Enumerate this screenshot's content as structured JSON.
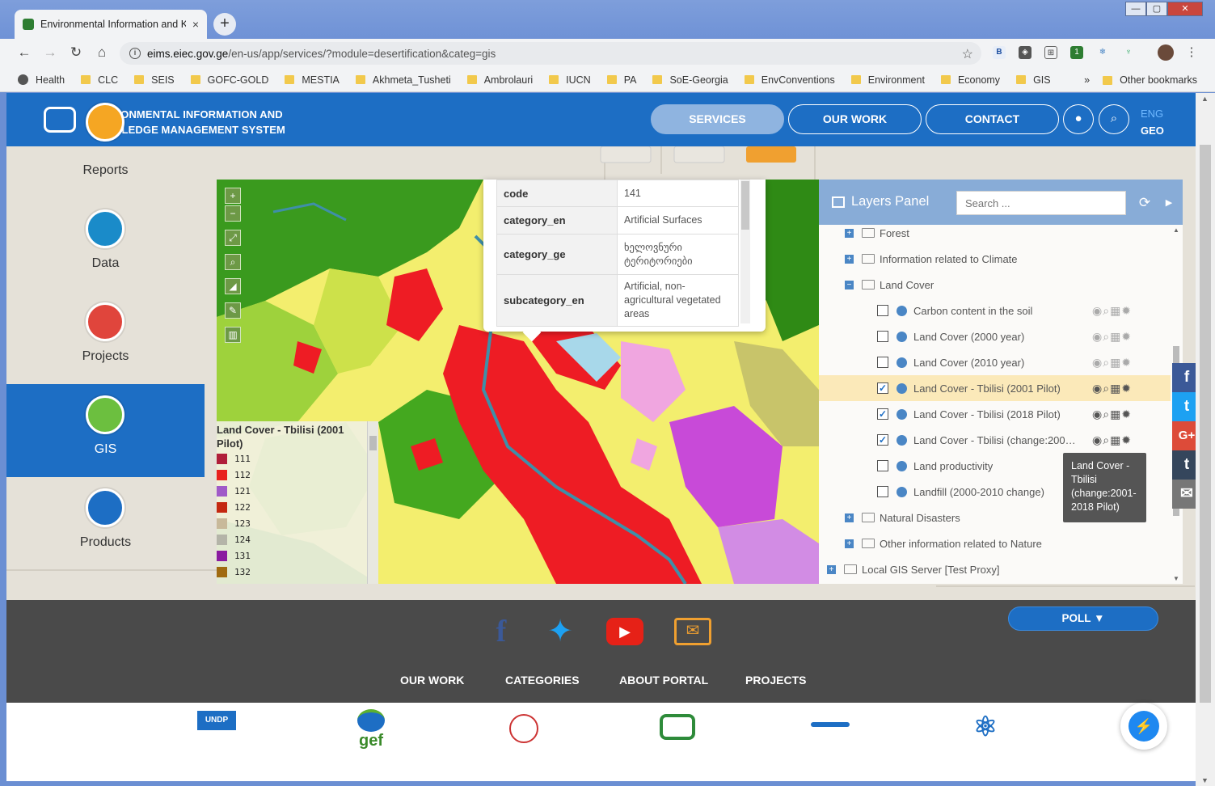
{
  "browser": {
    "tab_title": "Environmental Information and K",
    "tab_close": "×",
    "new_tab": "+",
    "url_domain": "eims.eiec.gov.ge",
    "url_path": "/en-us/app/services/?module=desertification&categ=gis",
    "bookmarks": [
      "Health",
      "CLC",
      "SEIS",
      "GOFC-GOLD",
      "MESTIA",
      "Akhmeta_Tusheti",
      "Ambrolauri",
      "IUCN",
      "PA",
      "SoE-Georgia",
      "EnvConventions",
      "Environment",
      "Economy",
      "GIS"
    ],
    "bookmarks_overflow": "»",
    "other_bookmarks": "Other bookmarks",
    "ext_badge": "1"
  },
  "header": {
    "title_line1": "ENVIRONMENTAL INFORMATION AND",
    "title_line2": "KNOWLEDGE MANAGEMENT SYSTEM",
    "nav": [
      "SERVICES",
      "OUR WORK",
      "CONTACT"
    ],
    "lang_eng": "ENG",
    "lang_geo": "GEO"
  },
  "sidebar": {
    "items": [
      {
        "label": "Reports",
        "color": "#f5a623"
      },
      {
        "label": "Data",
        "color": "#1a8bc9"
      },
      {
        "label": "Projects",
        "color": "#e0453c"
      },
      {
        "label": "GIS",
        "color": "#6cbf3f"
      },
      {
        "label": "Products",
        "color": "#1d6ec4"
      }
    ]
  },
  "map": {
    "zoom_in": "+",
    "zoom_out": "−"
  },
  "legend": {
    "title": "Land Cover - Tbilisi (2001 Pilot)",
    "rows": [
      {
        "code": "111",
        "color": "#b01e3a"
      },
      {
        "code": "112",
        "color": "#e8211e"
      },
      {
        "code": "121",
        "color": "#a05ac8"
      },
      {
        "code": "122",
        "color": "#c42810"
      },
      {
        "code": "123",
        "color": "#c8b99a"
      },
      {
        "code": "124",
        "color": "#b4b4a8"
      },
      {
        "code": "131",
        "color": "#8a1aa0"
      },
      {
        "code": "132",
        "color": "#a06a10"
      }
    ]
  },
  "popup": {
    "rows": [
      {
        "key": "code",
        "value": "141"
      },
      {
        "key": "category_en",
        "value": "Artificial Surfaces"
      },
      {
        "key": "category_ge",
        "value": "ხელოვნური ტერიტორიები"
      },
      {
        "key": "subcategory_en",
        "value": "Artificial, non-agricultural vegetated areas"
      }
    ]
  },
  "layers_panel": {
    "title": "Layers Panel",
    "search_placeholder": "Search ...",
    "rows": [
      {
        "label": "Forest",
        "kind": "group",
        "expanded": false
      },
      {
        "label": "Information related to Climate",
        "kind": "group",
        "expanded": false
      },
      {
        "label": "Land Cover",
        "kind": "group",
        "expanded": true
      },
      {
        "label": "Carbon content in the soil",
        "kind": "layer",
        "checked": false
      },
      {
        "label": "Land Cover (2000 year)",
        "kind": "layer",
        "checked": false
      },
      {
        "label": "Land Cover (2010 year)",
        "kind": "layer",
        "checked": false
      },
      {
        "label": "Land Cover - Tbilisi (2001 Pilot)",
        "kind": "layer",
        "checked": true
      },
      {
        "label": "Land Cover - Tbilisi (2018 Pilot)",
        "kind": "layer",
        "checked": true
      },
      {
        "label": "Land Cover - Tbilisi (change:2001...",
        "kind": "layer",
        "checked": true
      },
      {
        "label": "Land productivity",
        "kind": "layer",
        "checked": false
      },
      {
        "label": "Landfill (2000-2010 change)",
        "kind": "layer",
        "checked": false
      },
      {
        "label": "Natural Disasters",
        "kind": "group",
        "expanded": false
      },
      {
        "label": "Other information related to Nature",
        "kind": "group",
        "expanded": false
      },
      {
        "label": "Local GIS Server [Test Proxy]",
        "kind": "root",
        "expanded": false
      }
    ],
    "tooltip": "Land Cover - Tbilisi (change:2001-2018 Pilot)"
  },
  "social": [
    {
      "name": "facebook",
      "glyph": "f",
      "color": "#3b5998"
    },
    {
      "name": "twitter",
      "glyph": "t",
      "color": "#1da1f2"
    },
    {
      "name": "google-plus",
      "glyph": "G+",
      "color": "#dd4b39"
    },
    {
      "name": "tumblr",
      "glyph": "t",
      "color": "#35465c"
    },
    {
      "name": "email",
      "glyph": "✉",
      "color": "#777777"
    }
  ],
  "footer": {
    "links": [
      "OUR WORK",
      "CATEGORIES",
      "ABOUT PORTAL",
      "PROJECTS"
    ],
    "poll": "POLL",
    "partners": [
      "UNDP",
      "gef"
    ]
  }
}
